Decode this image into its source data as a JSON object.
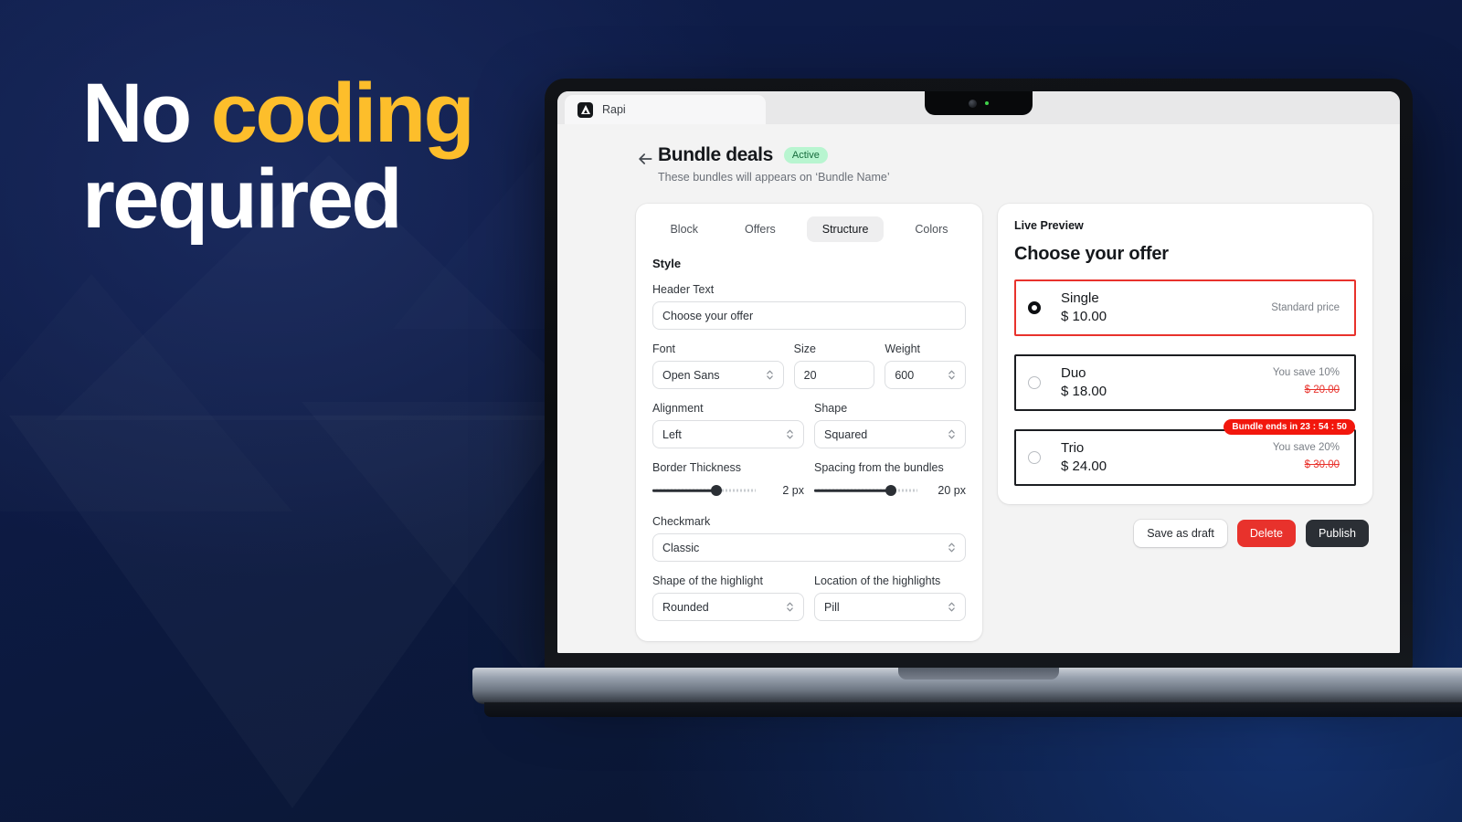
{
  "hero": {
    "line1_plain": "No ",
    "line1_accent": "coding",
    "line2": "required",
    "accent_color": "#fdbe2b"
  },
  "browser": {
    "tab_title": "Rapi",
    "favicon": "rapi-logo-icon"
  },
  "header": {
    "back_icon": "back-arrow-icon",
    "title": "Bundle deals",
    "status": "Active",
    "subtitle": "These bundles will appears on ‘Bundle Name’"
  },
  "tabs": [
    {
      "label": "Block",
      "active": false
    },
    {
      "label": "Offers",
      "active": false
    },
    {
      "label": "Structure",
      "active": true
    },
    {
      "label": "Colors",
      "active": false
    }
  ],
  "settings": {
    "section_title": "Style",
    "header_text": {
      "label": "Header Text",
      "value": "Choose your offer",
      "placeholder": "Choose your offer"
    },
    "font": {
      "label": "Font",
      "value": "Open Sans"
    },
    "size": {
      "label": "Size",
      "value": "20"
    },
    "weight": {
      "label": "Weight",
      "value": "600"
    },
    "alignment": {
      "label": "Alignment",
      "value": "Left"
    },
    "shape": {
      "label": "Shape",
      "value": "Squared"
    },
    "border_thickness": {
      "label": "Border Thickness",
      "value": "2 px",
      "percent": 62
    },
    "spacing": {
      "label": "Spacing from the bundles",
      "value": "20 px",
      "percent": 74
    },
    "checkmark": {
      "label": "Checkmark",
      "value": "Classic"
    },
    "highlight_shape": {
      "label": "Shape of the highlight",
      "value": "Rounded"
    },
    "highlight_location": {
      "label": "Location of the highlights",
      "value": "Pill"
    }
  },
  "preview": {
    "label": "Live Preview",
    "heading": "Choose your offer",
    "timer_badge": "Bundle ends in 23 : 54 : 50",
    "offers": [
      {
        "name": "Single",
        "price": "$ 10.00",
        "note": "Standard price",
        "compare": "",
        "selected": true
      },
      {
        "name": "Duo",
        "price": "$ 18.00",
        "note": "You save 10%",
        "compare": "$ 20.00",
        "selected": false
      },
      {
        "name": "Trio",
        "price": "$ 24.00",
        "note": "You save 20%",
        "compare": "$ 30.00",
        "selected": false
      }
    ]
  },
  "actions": {
    "save_draft": "Save as draft",
    "delete": "Delete",
    "publish": "Publish"
  }
}
